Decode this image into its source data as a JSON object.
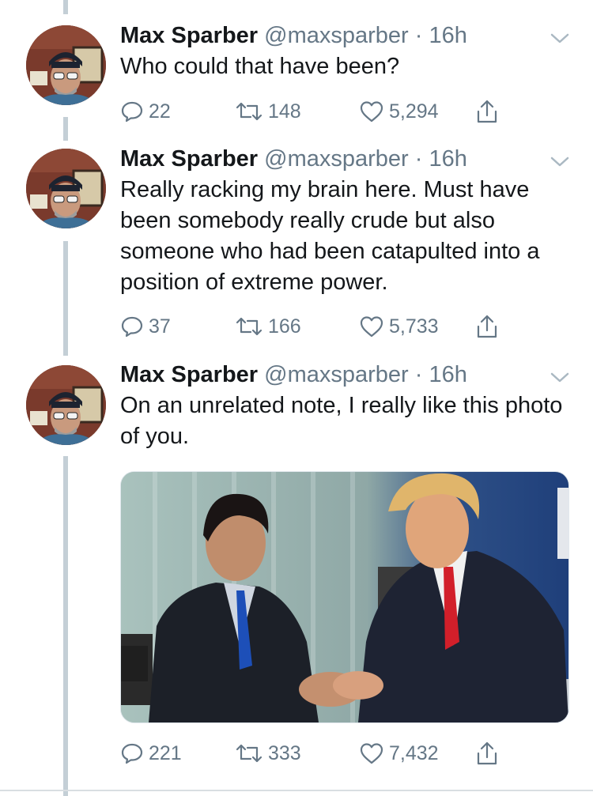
{
  "tweets": [
    {
      "name": "Max Sparber",
      "handle": "@maxsparber",
      "dot": "·",
      "time": "16h",
      "text": "Who could that have been?",
      "replies": "22",
      "retweets": "148",
      "likes": "5,294"
    },
    {
      "name": "Max Sparber",
      "handle": "@maxsparber",
      "dot": "·",
      "time": "16h",
      "text": "Really racking my brain here. Must have been somebody really crude but also someone who had been catapulted into a position of extreme power.",
      "replies": "37",
      "retweets": "166",
      "likes": "5,733"
    },
    {
      "name": "Max Sparber",
      "handle": "@maxsparber",
      "dot": "·",
      "time": "16h",
      "text": "On an unrelated note, I really like this photo of you.",
      "replies": "221",
      "retweets": "333",
      "likes": "7,432"
    }
  ],
  "colors": {
    "text": "#14171a",
    "secondary": "#657786",
    "thread_line": "#c4cfd6"
  },
  "icons": [
    "reply-icon",
    "retweet-icon",
    "like-icon",
    "share-icon",
    "chevron-down-icon"
  ]
}
